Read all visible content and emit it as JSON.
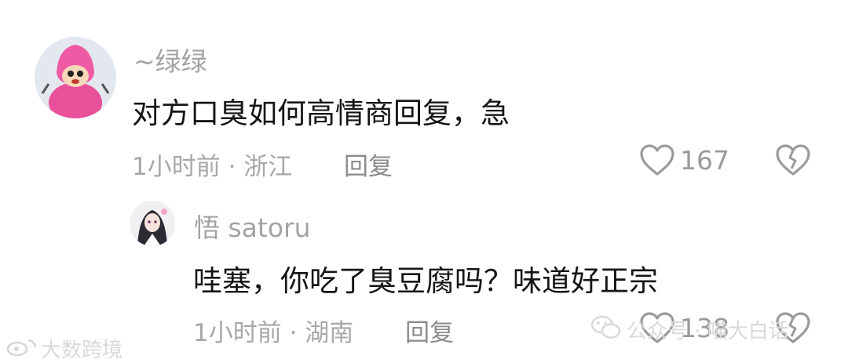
{
  "comment": {
    "username": "~绿绿",
    "text": "对方口臭如何高情商回复，急",
    "time_location": "1小时前 · 浙江",
    "reply_label": "回复",
    "like_count": "167"
  },
  "reply": {
    "username": "悟 satoru",
    "text": "哇塞，你吃了臭豆腐吗？味道好正宗",
    "time_location": "1小时前 · 湖南",
    "reply_label": "回复",
    "like_count": "138"
  },
  "watermarks": {
    "left": "大数跨境",
    "right": "公众号 · 喵大白话"
  },
  "icons": {
    "like": "heart-outline-icon",
    "dislike": "broken-heart-icon",
    "wechat": "wechat-icon",
    "weibo": "weibo-icon"
  }
}
